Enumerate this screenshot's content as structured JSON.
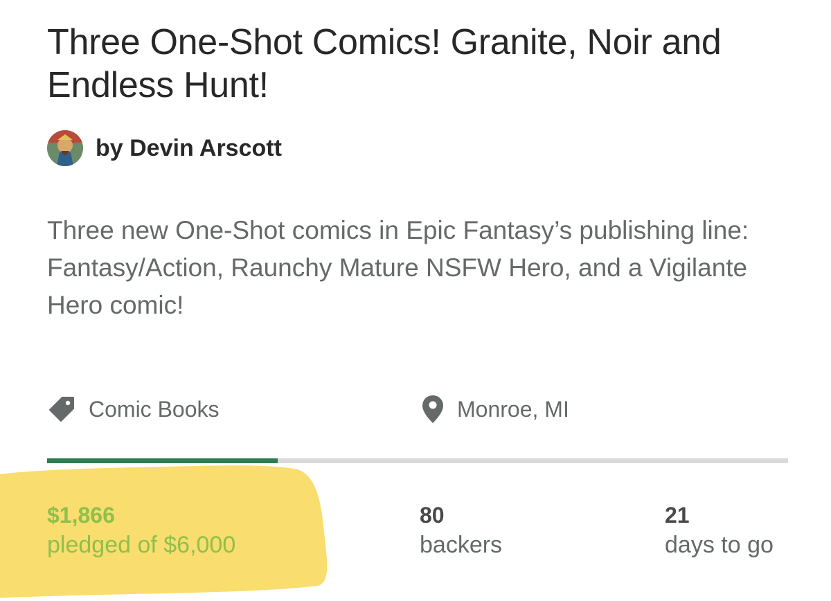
{
  "project": {
    "title": "Three One-Shot Comics! Granite, Noir and Endless Hunt!",
    "creator": "by Devin Arscott",
    "blurb": "Three new One-Shot comics in Epic Fantasy’s publishing line: Fantasy/Action, Raunchy Mature NSFW Hero, and a Vigilante Hero comic!"
  },
  "meta": {
    "category": {
      "icon": "tag-icon",
      "label": "Comic Books"
    },
    "location": {
      "icon": "location-pin-icon",
      "label": "Monroe, MI"
    }
  },
  "funding": {
    "progress_fraction": 0.311,
    "pledged_value": "$1,866",
    "pledged_label": "pledged of $6,000",
    "backers_value": "80",
    "backers_label": "backers",
    "days_value": "21",
    "days_label": "days to go"
  },
  "colors": {
    "progress_green": "#2e7d4f",
    "pledged_green": "#8fbf4c",
    "highlighter_yellow": "#f8d85a"
  }
}
